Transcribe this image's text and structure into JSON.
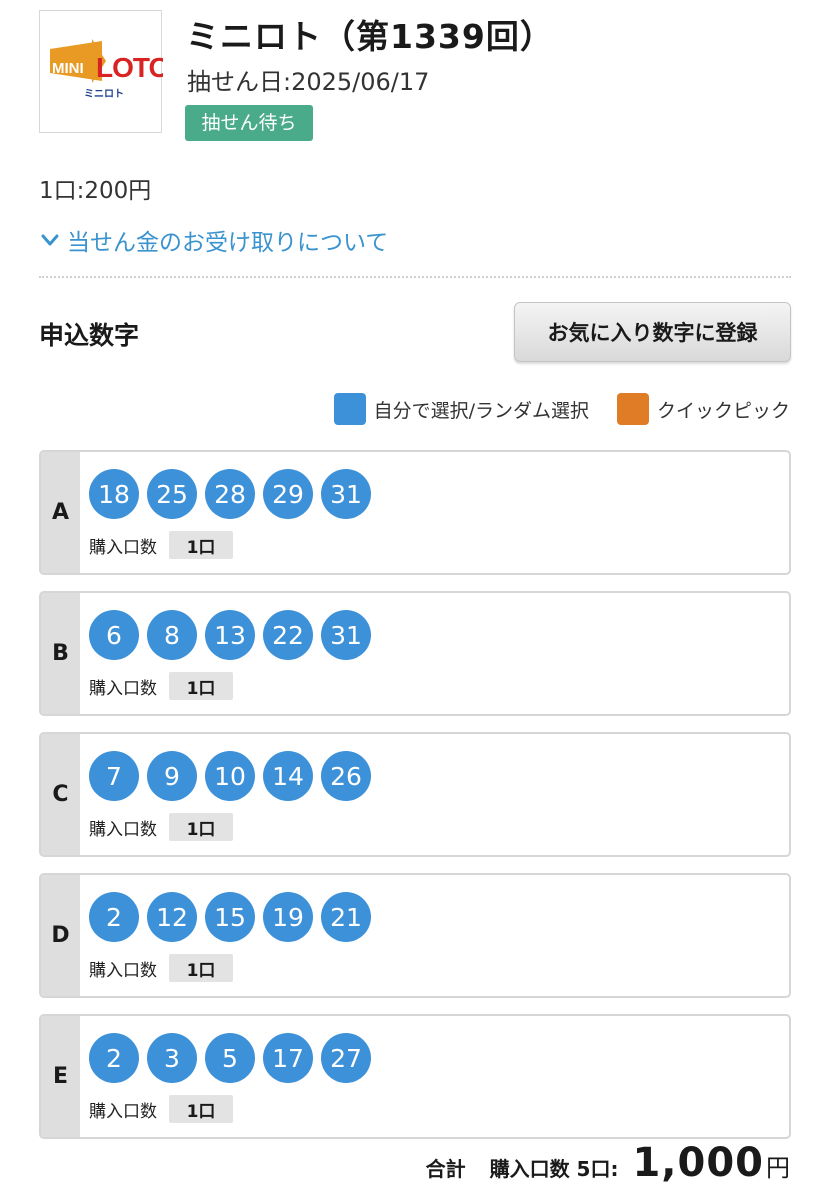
{
  "header": {
    "logo_text": "MINI LOTO",
    "logo_subtext": "ミニロト",
    "title": "ミニロト（第1339回）",
    "draw_date": "抽せん日:2025/06/17",
    "status_badge": "抽せん待ち"
  },
  "unit_price": "1口:200円",
  "payout_link": "当せん金のお受け取りについて",
  "section_title": "申込数字",
  "favorite_button": "お気に入り数字に登録",
  "legend": {
    "self_select": "自分で選択/ランダム選択",
    "quick_pick": "クイックピック",
    "self_select_color": "#3d91d9",
    "quick_pick_color": "#e07c26"
  },
  "tickets": [
    {
      "letter": "A",
      "numbers": [
        "18",
        "25",
        "28",
        "29",
        "31"
      ],
      "qty_label": "購入口数",
      "qty": "1口"
    },
    {
      "letter": "B",
      "numbers": [
        "6",
        "8",
        "13",
        "22",
        "31"
      ],
      "qty_label": "購入口数",
      "qty": "1口"
    },
    {
      "letter": "C",
      "numbers": [
        "7",
        "9",
        "10",
        "14",
        "26"
      ],
      "qty_label": "購入口数",
      "qty": "1口"
    },
    {
      "letter": "D",
      "numbers": [
        "2",
        "12",
        "15",
        "19",
        "21"
      ],
      "qty_label": "購入口数",
      "qty": "1口"
    },
    {
      "letter": "E",
      "numbers": [
        "2",
        "3",
        "5",
        "17",
        "27"
      ],
      "qty_label": "購入口数",
      "qty": "1口"
    }
  ],
  "total": {
    "label": "合計",
    "count": "購入口数 5口:",
    "amount": "1,000",
    "unit": "円"
  }
}
